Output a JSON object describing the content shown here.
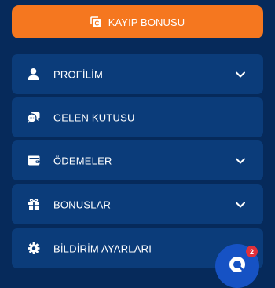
{
  "bonus_button": {
    "label": "KAYIP BONUSU",
    "icon": "coin-return-icon"
  },
  "menu": {
    "items": [
      {
        "label": "PROFİLİM",
        "icon": "user-icon",
        "has_chevron": true
      },
      {
        "label": "GELEN KUTUSU",
        "icon": "chat-bubbles-icon",
        "has_chevron": false
      },
      {
        "label": "ÖDEMELER",
        "icon": "wallet-icon",
        "has_chevron": true
      },
      {
        "label": "BONUSLAR",
        "icon": "gift-icon",
        "has_chevron": true
      },
      {
        "label": "BİLDİRİM AYARLARI",
        "icon": "gear-icon",
        "has_chevron": false
      }
    ]
  },
  "support": {
    "badge_count": "2",
    "icon": "chat-support-icon"
  },
  "colors": {
    "background": "#062a5b",
    "menu_item": "#0b3c7a",
    "accent_orange": "#f5771f",
    "support_blue": "#1652c4",
    "badge_red": "#e0303a"
  }
}
